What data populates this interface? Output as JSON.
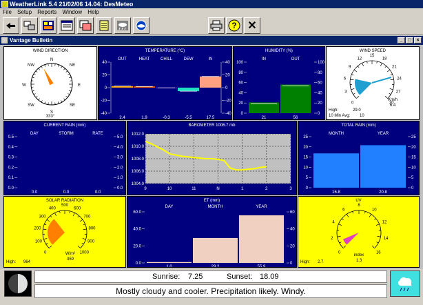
{
  "window": {
    "title": "WeatherLink 5.4  21/02/06  14.04: DesMeteo"
  },
  "menu": [
    "File",
    "Setup",
    "Reports",
    "Window",
    "Help"
  ],
  "toolbar": {
    "left": [
      "download-icon",
      "connect-icon",
      "summary-icon",
      "browse-icon",
      "graph-icon",
      "notepad-icon",
      "weather-report-icon",
      "noaa-icon"
    ],
    "right": [
      "print-icon",
      "help-icon",
      "close-icon"
    ],
    "help_glyph": "?",
    "close_glyph": "✕"
  },
  "bulletin": {
    "title": "Vantage Bulletin",
    "btn_min": "_",
    "btn_max": "□",
    "btn_close": "×"
  },
  "wind_direction": {
    "title": "WIND DIRECTION",
    "value": "333°",
    "degrees": 333,
    "labels": [
      "N",
      "NE",
      "E",
      "SE",
      "S",
      "SW",
      "W",
      "NW"
    ]
  },
  "temperature": {
    "title": "TEMPERATURE (°C)",
    "columns": [
      "OUT",
      "HEAT",
      "CHILL",
      "DEW",
      "IN"
    ],
    "values": [
      "2.4",
      "1.9",
      "-0.3",
      "-5.5",
      "17.5"
    ],
    "nums": [
      2.4,
      1.9,
      -0.3,
      -5.5,
      17.5
    ],
    "colors": [
      "#ffa500",
      "#ff6000",
      "#8040c0",
      "#20e0c0",
      "#ffa080"
    ],
    "ticks": [
      "40",
      "20",
      "0",
      "-20",
      "-40"
    ],
    "ylim": [
      -40,
      40
    ]
  },
  "humidity": {
    "title": "HUMIDITY (%)",
    "columns": [
      "IN",
      "OUT"
    ],
    "values": [
      "21",
      "56"
    ],
    "nums": [
      21,
      56
    ],
    "ticks": [
      "100",
      "80",
      "60",
      "40",
      "20",
      "0"
    ],
    "ylim": [
      0,
      100
    ]
  },
  "wind_speed": {
    "title": "WIND SPEED",
    "unit": "Km/h",
    "value": "6.4",
    "speed": 6.4,
    "ticks": [
      "0",
      "3",
      "6",
      "9",
      "12",
      "15",
      "18",
      "21",
      "24",
      "27",
      "30"
    ],
    "high_label": "High:",
    "high_value": "29.0",
    "avg_label": "10 Min Avg:",
    "avg_value": "10"
  },
  "current_rain": {
    "title": "CURRENT RAIN  (mm)",
    "columns": [
      "DAY",
      "STORM",
      "RATE"
    ],
    "values": [
      "0.0",
      "0.0",
      "0.0"
    ],
    "left_ticks": [
      "0.5",
      "0.4",
      "0.3",
      "0.2",
      "0.1",
      "0.0"
    ],
    "right_ticks": [
      "5.0",
      "4.0",
      "3.0",
      "2.0",
      "1.0",
      "0.0"
    ]
  },
  "barometer": {
    "title": "BAROMETER 1006.7 mb",
    "y_ticks": [
      "1012.0",
      "1010.0",
      "1008.0",
      "1006.0",
      "1004.0"
    ],
    "x_ticks": [
      "9",
      "10",
      "11",
      "N",
      "1",
      "2",
      "3"
    ]
  },
  "total_rain": {
    "title": "TOTAL RAIN  (mm)",
    "columns": [
      "MONTH",
      "YEAR"
    ],
    "values": [
      "16.8",
      "20.8"
    ],
    "ticks": [
      "25",
      "20",
      "15",
      "10",
      "5",
      "0"
    ]
  },
  "solar": {
    "title": "SOLAR RADIATION",
    "unit": "W/m²",
    "value": "359",
    "watts": 359,
    "ticks": [
      "0",
      "100",
      "200",
      "300",
      "400",
      "500",
      "600",
      "700",
      "800",
      "900",
      "1000"
    ],
    "high_label": "High:",
    "high_value": "964"
  },
  "et": {
    "title": "ET (mm)",
    "columns": [
      "DAY",
      "MONTH",
      "YEAR"
    ],
    "values": [
      "1.0",
      "29.2",
      "55.9"
    ],
    "nums": [
      1.0,
      29.2,
      55.9
    ],
    "left_ticks": [
      "60.0",
      "40.0",
      "20.0",
      "0.0"
    ],
    "right_ticks": [
      "60",
      "40",
      "20",
      "0"
    ],
    "ylim": [
      0,
      60
    ]
  },
  "uv": {
    "title": "UV",
    "unit": "index",
    "value": "1.3",
    "index": 1.3,
    "ticks": [
      "0",
      "2",
      "4",
      "6",
      "8",
      "10",
      "12",
      "14",
      "16"
    ],
    "high_label": "High:",
    "high_value": "2.7"
  },
  "sun": {
    "sunrise_label": "Sunrise:",
    "sunrise": "7.25",
    "sunset_label": "Sunset:",
    "sunset": "18.09"
  },
  "forecast": {
    "text": "Mostly cloudy and cooler.  Precipitation likely.  Windy."
  },
  "chart_data": [
    {
      "type": "bar",
      "title": "TEMPERATURE (°C)",
      "categories": [
        "OUT",
        "HEAT",
        "CHILL",
        "DEW",
        "IN"
      ],
      "values": [
        2.4,
        1.9,
        -0.3,
        -5.5,
        17.5
      ],
      "ylim": [
        -40,
        40
      ]
    },
    {
      "type": "bar",
      "title": "HUMIDITY (%)",
      "categories": [
        "IN",
        "OUT"
      ],
      "values": [
        21,
        56
      ],
      "ylim": [
        0,
        100
      ]
    },
    {
      "type": "line",
      "title": "BAROMETER 1006.7 mb",
      "x": [
        "9",
        "10",
        "11",
        "N",
        "1",
        "2"
      ],
      "values": [
        1010.8,
        1010.4,
        1009.9,
        1009.4,
        1008.8,
        1008.6,
        1008.4,
        1008.3,
        1008.2,
        1008.1,
        1008.0,
        1008.0,
        1007.9,
        1007.7,
        1006.5,
        1006.2,
        1006.2,
        1006.3,
        1006.4,
        1006.6,
        1006.7
      ],
      "ylim": [
        1004,
        1012
      ]
    },
    {
      "type": "bar",
      "title": "TOTAL RAIN  (mm)",
      "categories": [
        "MONTH",
        "YEAR"
      ],
      "values": [
        16.8,
        20.8
      ],
      "ylim": [
        0,
        25
      ]
    },
    {
      "type": "bar",
      "title": "ET (mm)",
      "categories": [
        "DAY",
        "MONTH",
        "YEAR"
      ],
      "values": [
        1.0,
        29.2,
        55.9
      ],
      "ylim": [
        0,
        60
      ]
    }
  ]
}
